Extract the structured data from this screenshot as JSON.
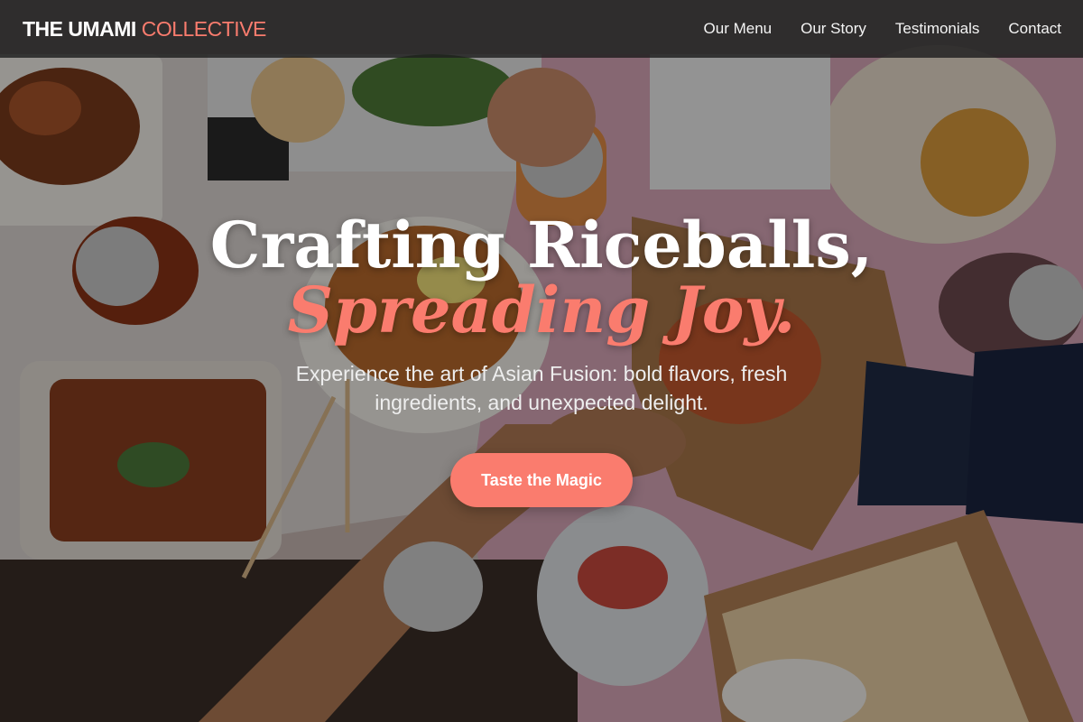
{
  "nav": {
    "brand_main": "THE UMAMI",
    "brand_accent": "COLLECTIVE",
    "links": [
      "Our Menu",
      "Our Story",
      "Testimonials",
      "Contact"
    ]
  },
  "hero": {
    "headline_line1": "Crafting Riceballs,",
    "headline_line2": "Spreading Joy.",
    "subheadline": "Experience the art of Asian Fusion: bold flavors, fresh ingredients, and unexpected delight.",
    "cta_label": "Taste the Magic"
  },
  "colors": {
    "accent": "#fa7c6e",
    "nav_background": "#1e1e1e",
    "text_primary": "#ffffff"
  }
}
